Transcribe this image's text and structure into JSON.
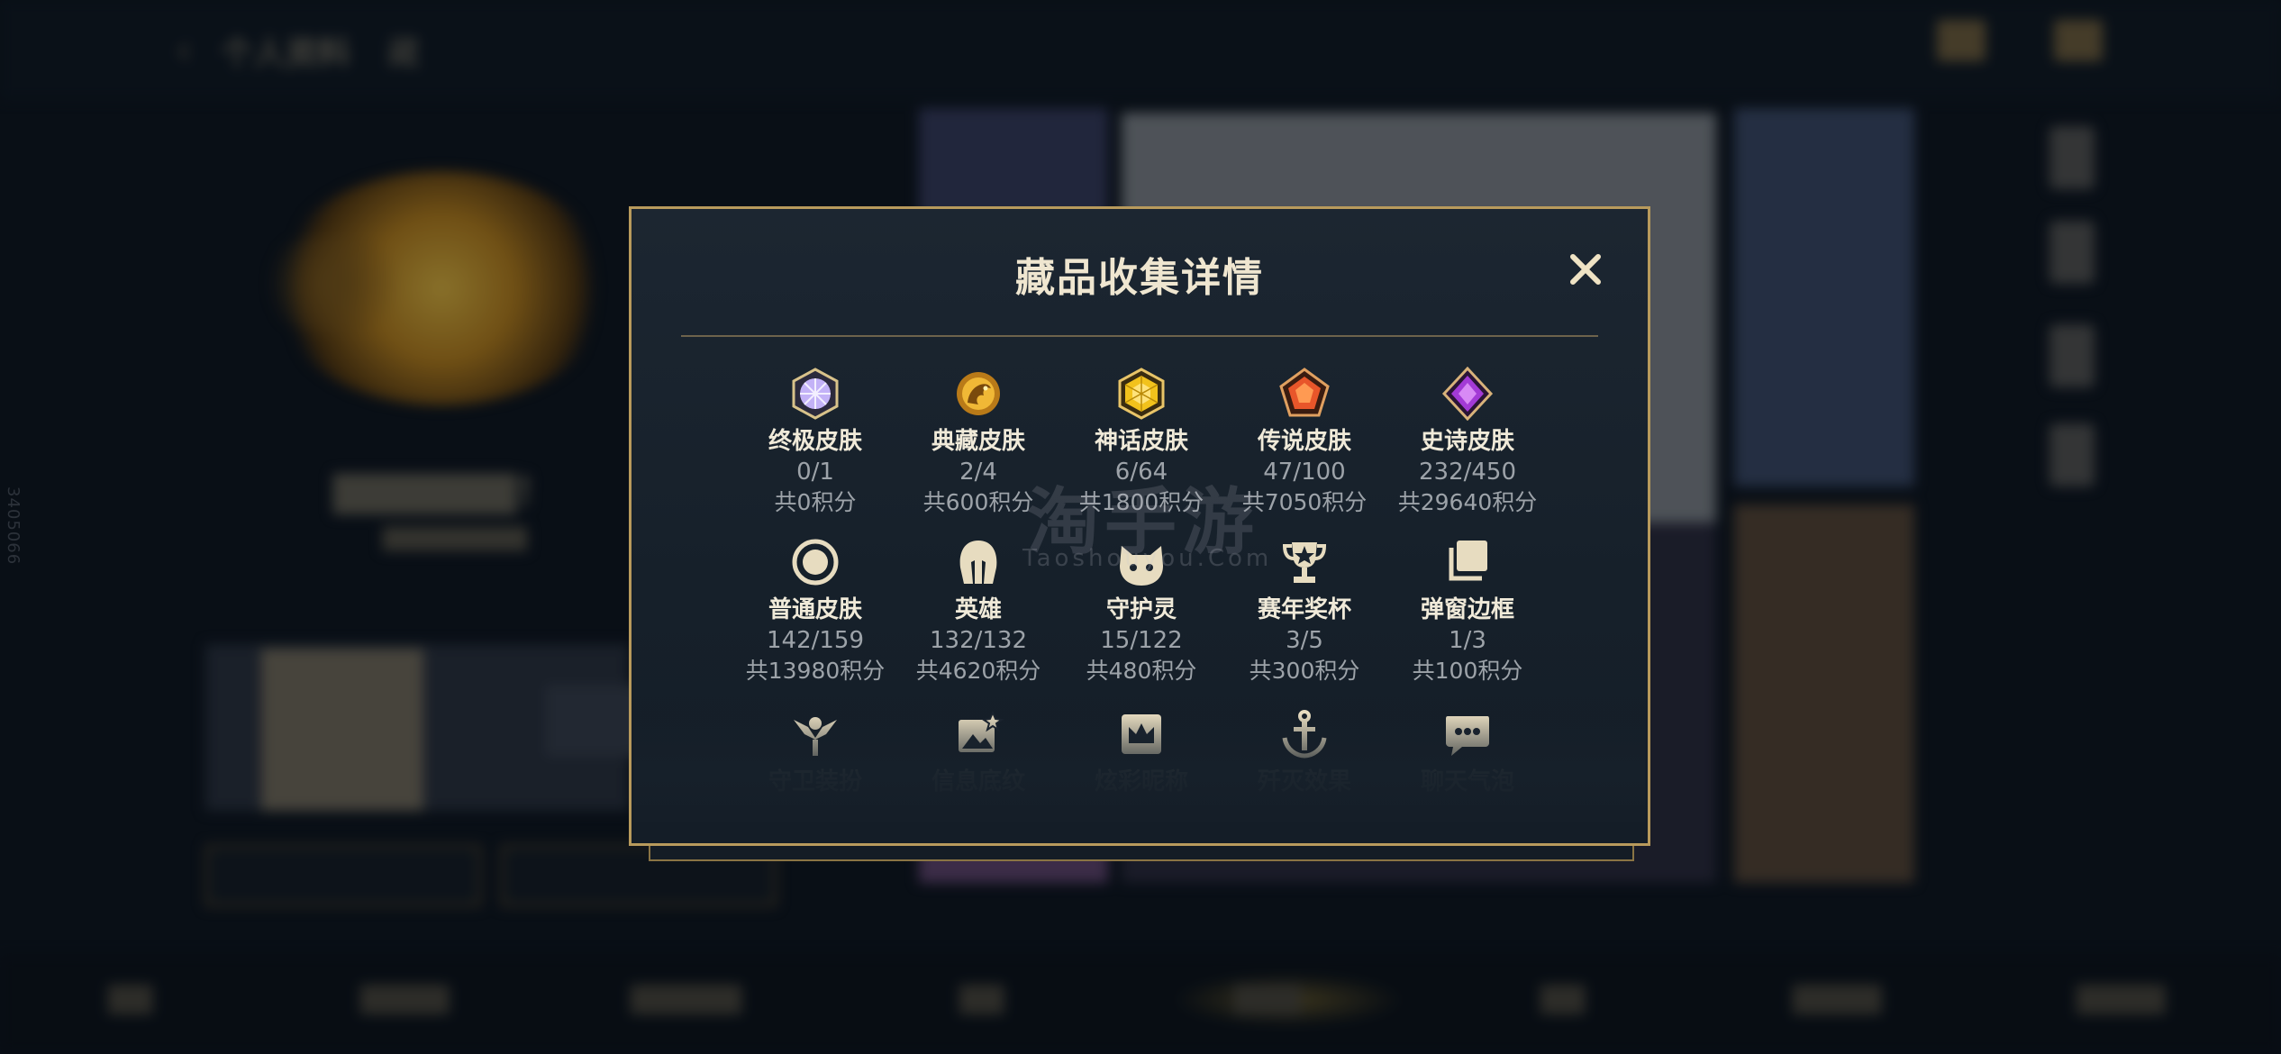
{
  "background": {
    "back_title": "个人资料",
    "tab": "藏",
    "side_code": "3405066"
  },
  "modal": {
    "title": "藏品收集详情"
  },
  "collections": [
    {
      "label": "终极皮肤",
      "count": "0/1",
      "points": "共0积分",
      "icon": "ultimate-gem-icon",
      "color": "#b9a3f5"
    },
    {
      "label": "典藏皮肤",
      "count": "2/4",
      "points": "共600积分",
      "icon": "dragon-crest-icon",
      "color": "#e4a52a"
    },
    {
      "label": "神话皮肤",
      "count": "6/64",
      "points": "共1800积分",
      "icon": "mythic-gem-icon",
      "color": "#f2c21c"
    },
    {
      "label": "传说皮肤",
      "count": "47/100",
      "points": "共7050积分",
      "icon": "legendary-gem-icon",
      "color": "#e8562a"
    },
    {
      "label": "史诗皮肤",
      "count": "232/450",
      "points": "共29640积分",
      "icon": "epic-gem-icon",
      "color": "#a33ad6"
    },
    {
      "label": "普通皮肤",
      "count": "142/159",
      "points": "共13980积分",
      "icon": "circle-icon",
      "color": "#e7dcc0"
    },
    {
      "label": "英雄",
      "count": "132/132",
      "points": "共4620积分",
      "icon": "helmet-icon",
      "color": "#e7dcc0"
    },
    {
      "label": "守护灵",
      "count": "15/122",
      "points": "共480积分",
      "icon": "cat-icon",
      "color": "#e7dcc0"
    },
    {
      "label": "赛年奖杯",
      "count": "3/5",
      "points": "共300积分",
      "icon": "trophy-icon",
      "color": "#e7dcc0"
    },
    {
      "label": "弹窗边框",
      "count": "1/3",
      "points": "共100积分",
      "icon": "frames-icon",
      "color": "#e7dcc0"
    },
    {
      "label": "守卫装扮",
      "icon": "ward-icon",
      "color": "#e7dcc0"
    },
    {
      "label": "信息底纹",
      "icon": "image-sparkle-icon",
      "color": "#e7dcc0"
    },
    {
      "label": "炫彩昵称",
      "icon": "crown-card-icon",
      "color": "#e7dcc0"
    },
    {
      "label": "歼灭效果",
      "icon": "anchor-icon",
      "color": "#e7dcc0"
    },
    {
      "label": "聊天气泡",
      "icon": "chat-bubble-icon",
      "color": "#e7dcc0"
    }
  ],
  "watermark": {
    "main": "淘手游",
    "sub": "Taoshouyou.Com"
  }
}
